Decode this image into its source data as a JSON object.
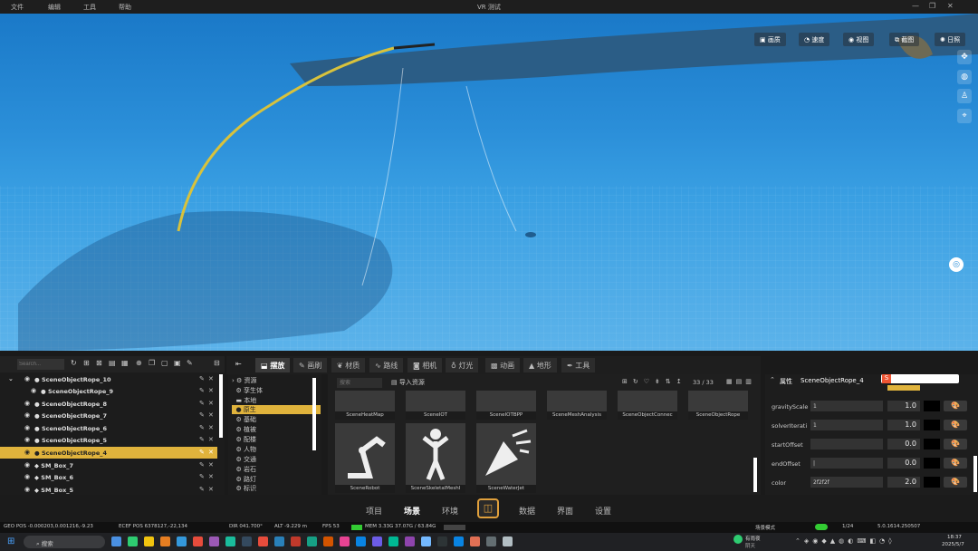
{
  "app": {
    "title": "VR 测试"
  },
  "menu": [
    "文件",
    "编辑",
    "工具",
    "帮助"
  ],
  "view_buttons": [
    {
      "icon": "image-icon",
      "label": "画质"
    },
    {
      "icon": "speedometer-icon",
      "label": "速度"
    },
    {
      "icon": "eye-icon",
      "label": "视图"
    },
    {
      "icon": "screenshot-icon",
      "label": "截图"
    },
    {
      "icon": "sun-icon",
      "label": "日照"
    }
  ],
  "outline": {
    "search_placeholder": "Search...",
    "items": [
      "SceneObjectRope_10",
      "SceneObjectRope_9",
      "SceneObjectRope_8",
      "SceneObjectRope_7",
      "SceneObjectRope_6",
      "SceneObjectRope_5",
      "SceneObjectRope_4",
      "SM_Box_7",
      "SM_Box_6",
      "SM_Box_5"
    ],
    "selected": "SceneObjectRope_4"
  },
  "tabs": [
    "摆放",
    "画刷",
    "材质",
    "路线",
    "相机",
    "灯光",
    "动画",
    "地形",
    "工具"
  ],
  "active_tab": "摆放",
  "tree": {
    "items": [
      "资源",
      "孪生体",
      "本地",
      "原生",
      "基础",
      "植被",
      "配楼",
      "人物",
      "交通",
      "岩石",
      "路灯",
      "标识"
    ],
    "selected": "原生"
  },
  "assets": {
    "search_placeholder": "搜索",
    "import_label": "导入资源",
    "page": "33 / 33",
    "row1": [
      "SceneHeatMap",
      "SceneIOT",
      "SceneIOTBPP",
      "SceneMeshAnalysis",
      "SceneObjectConnec",
      "SceneObjectRope"
    ],
    "row2": [
      "SceneRobot",
      "SceneSkeletalMeshI",
      "SceneWaterJet"
    ]
  },
  "properties": {
    "header": "属性",
    "object": "SceneObjectRope_4",
    "rows": [
      {
        "label": "gravityScale",
        "value": "1",
        "num": "1.0"
      },
      {
        "label": "solverIterati",
        "value": "1",
        "num": "1.0"
      },
      {
        "label": "startOffset",
        "value": "",
        "num": "0.0"
      },
      {
        "label": "endOffset",
        "value": "|",
        "num": "0.0"
      },
      {
        "label": "color",
        "value": "2f2f2f",
        "num": "2.0"
      }
    ]
  },
  "bottom_nav": [
    "项目",
    "场景",
    "环境",
    "数据",
    "界面",
    "设置"
  ],
  "active_nav": "场景",
  "status": {
    "geo_pos": "GEO POS -0.000203,0.001216,-9.23",
    "ecef_pos": "ECEF POS 6378127,-22,134",
    "dir": "DIR 041.700°",
    "alt": "ALT -9.229 m",
    "fps": "FPS 53",
    "mem": "MEM 3.33G 37.07G / 63.84G",
    "mode": "场景模式",
    "frames": "1/24",
    "version": "5.0.1614.250507"
  },
  "taskbar": {
    "search": "搜索",
    "time": "18:37",
    "date": "2025/5/7",
    "weather": "有雨夜",
    "weather_sub": "阴天"
  },
  "colors": {
    "accent": "#e0b33c",
    "water_top": "#1a79c8",
    "water_bottom": "#5cb3ea"
  }
}
